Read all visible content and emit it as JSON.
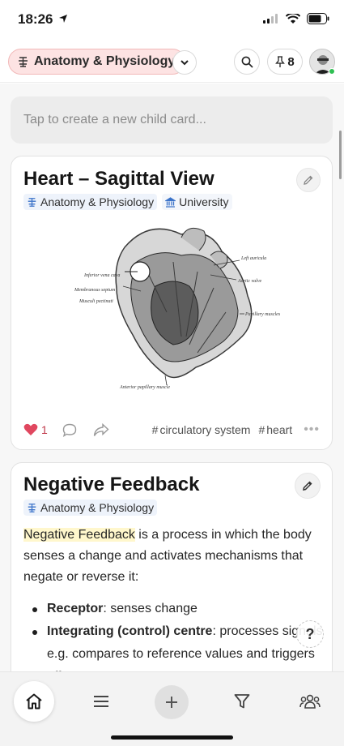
{
  "status_bar": {
    "time": "18:26"
  },
  "header": {
    "title": "Anatomy & Physiology",
    "pinned_count": "8"
  },
  "feed": {
    "new_child_placeholder": "Tap to create a new child card..."
  },
  "cards": [
    {
      "title": "Heart – Sagittal View",
      "tags": [
        "Anatomy & Physiology",
        "University"
      ],
      "image_labels": [
        "Left auricula",
        "Aortic valve",
        "Inferior vena cava",
        "Membranous septum",
        "Musculi pectinati",
        "Papillary muscles",
        "Anterior papillary muscle"
      ],
      "likes": "1",
      "hashtags": [
        "circulatory system",
        "heart"
      ]
    },
    {
      "title": "Negative Feedback",
      "tags": [
        "Anatomy & Physiology"
      ],
      "body_highlight": "Negative Feedback",
      "body_rest": " is a process in which the body senses a change and activates mechanisms that negate or reverse it:",
      "bullets": [
        {
          "bold": "Receptor",
          "text": ": senses change"
        },
        {
          "bold": "Integrating (control) centre",
          "text": ": processes signals e.g. compares to reference values and triggers effectors"
        }
      ]
    }
  ],
  "help_label": "?",
  "colors": {
    "title_pill_bg": "#fde3e3",
    "like_red": "#e0475f",
    "highlight": "#fff7cc",
    "online_green": "#2fbf52"
  },
  "icons": {
    "header": [
      "location-arrow-icon",
      "signal-icon",
      "wifi-icon",
      "battery-icon",
      "subject-icon",
      "chevron-down-icon",
      "search-icon",
      "pin-icon",
      "avatar"
    ],
    "nav": [
      "home-icon",
      "menu-icon",
      "plus-icon",
      "filter-icon",
      "people-icon"
    ]
  }
}
